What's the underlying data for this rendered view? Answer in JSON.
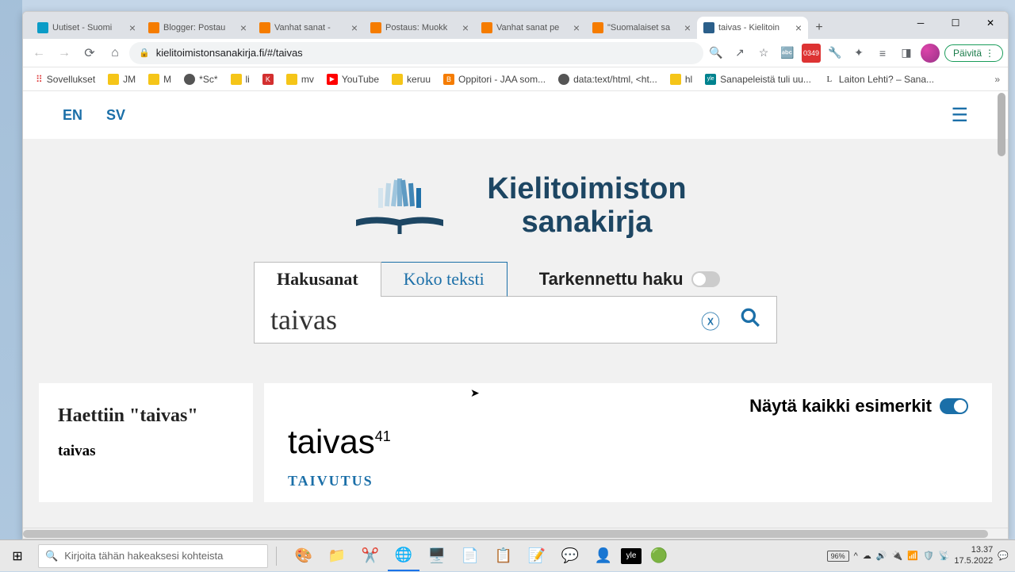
{
  "window": {
    "minimize": "─",
    "maximize": "☐",
    "close": "✕"
  },
  "tabs": [
    {
      "title": "Uutiset - Suomi",
      "favcolor": "#0b9cc7"
    },
    {
      "title": "Blogger: Postau",
      "favcolor": "#f57c00"
    },
    {
      "title": "Vanhat sanat -",
      "favcolor": "#f57c00"
    },
    {
      "title": "Postaus: Muokk",
      "favcolor": "#f57c00"
    },
    {
      "title": "Vanhat sanat pe",
      "favcolor": "#f57c00"
    },
    {
      "title": "\"Suomalaiset sa",
      "favcolor": "#f57c00"
    },
    {
      "title": "taivas - Kielitoin",
      "favcolor": "#2b5f8a",
      "active": true
    }
  ],
  "address": {
    "url": "kielitoimistonsanakirja.fi/#/taivas",
    "update_label": "Päivitä"
  },
  "bookmarks": [
    {
      "label": "Sovellukset",
      "icon": "apps"
    },
    {
      "label": "JM",
      "color": "#f5c518"
    },
    {
      "label": "M",
      "color": "#f5c518"
    },
    {
      "label": "*Sc*",
      "color": "#555"
    },
    {
      "label": "li",
      "color": "#f5c518"
    },
    {
      "label": "",
      "color": "#d32f2f",
      "char": "K"
    },
    {
      "label": "mv",
      "color": "#f5c518"
    },
    {
      "label": "YouTube",
      "color": "#ff0000",
      "char": "▶"
    },
    {
      "label": "keruu",
      "color": "#f5c518"
    },
    {
      "label": "Oppitori - JAA som...",
      "color": "#f57c00",
      "char": "B"
    },
    {
      "label": "data:text/html, <ht...",
      "color": "#555"
    },
    {
      "label": "hl",
      "color": "#f5c518"
    },
    {
      "label": "Sanapeleistä tuli uu...",
      "color": "#00838f",
      "char": "yle"
    },
    {
      "label": "Laiton Lehti? – Sana...",
      "color": "#555",
      "char": "L"
    }
  ],
  "page": {
    "lang_en": "EN",
    "lang_sv": "SV",
    "title_line1": "Kielitoimiston",
    "title_line2": "sanakirja",
    "tab_hakusanat": "Hakusanat",
    "tab_kokoteksti": "Koko teksti",
    "advanced": "Tarkennettu haku",
    "search_value": "taivas",
    "sidebar_heading": "Haettiin \"taivas\"",
    "sidebar_term": "taivas",
    "show_examples": "Näytä kaikki esimerkit",
    "headword": "taivas",
    "headword_sup": "41",
    "taivutus": "TAIVUTUS"
  },
  "taskbar": {
    "search_placeholder": "Kirjoita tähän hakeaksesi kohteista",
    "battery": "96%",
    "time": "13.37",
    "date": "17.5.2022"
  }
}
